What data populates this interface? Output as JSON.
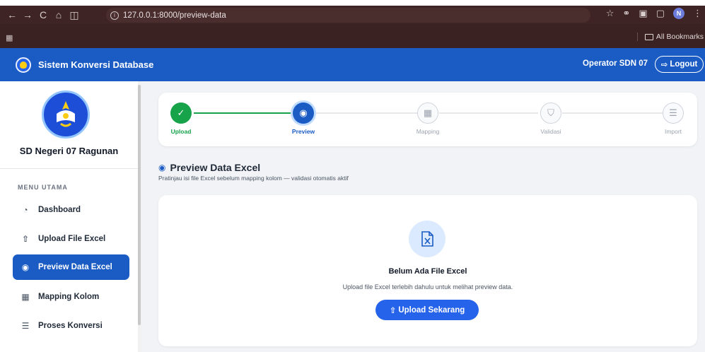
{
  "browser": {
    "url": "127.0.0.1:8000/preview-data",
    "all_bookmarks": "All Bookmarks",
    "profile_initial": "N"
  },
  "header": {
    "title": "Sistem Konversi Database",
    "operator": "Operator SDN 07",
    "logout": "Logout"
  },
  "sidebar": {
    "school_name": "SD Negeri 07 Ragunan",
    "menu_title": "MENU UTAMA",
    "items": [
      {
        "label": "Dashboard",
        "icon": "dashboard-icon"
      },
      {
        "label": "Upload File Excel",
        "icon": "upload-icon"
      },
      {
        "label": "Preview Data Excel",
        "icon": "eye-icon",
        "active": true
      },
      {
        "label": "Mapping Kolom",
        "icon": "table-icon"
      },
      {
        "label": "Proses Konversi",
        "icon": "database-icon"
      }
    ]
  },
  "stepper": {
    "steps": [
      {
        "label": "Upload",
        "state": "done"
      },
      {
        "label": "Preview",
        "state": "current"
      },
      {
        "label": "Mapping",
        "state": "pending"
      },
      {
        "label": "Validasi",
        "state": "pending"
      },
      {
        "label": "Import",
        "state": "pending"
      }
    ]
  },
  "main": {
    "title": "Preview Data Excel",
    "subtitle": "Pratinjau isi file Excel sebelum mapping kolom — validasi otomatis aktif",
    "empty_title": "Belum Ada File Excel",
    "empty_desc": "Upload file Excel terlebih dahulu untuk melihat preview data.",
    "upload_button": "Upload Sekarang"
  },
  "colors": {
    "primary": "#1a5bc4",
    "success": "#16a34a",
    "background": "#f1f3f6"
  }
}
